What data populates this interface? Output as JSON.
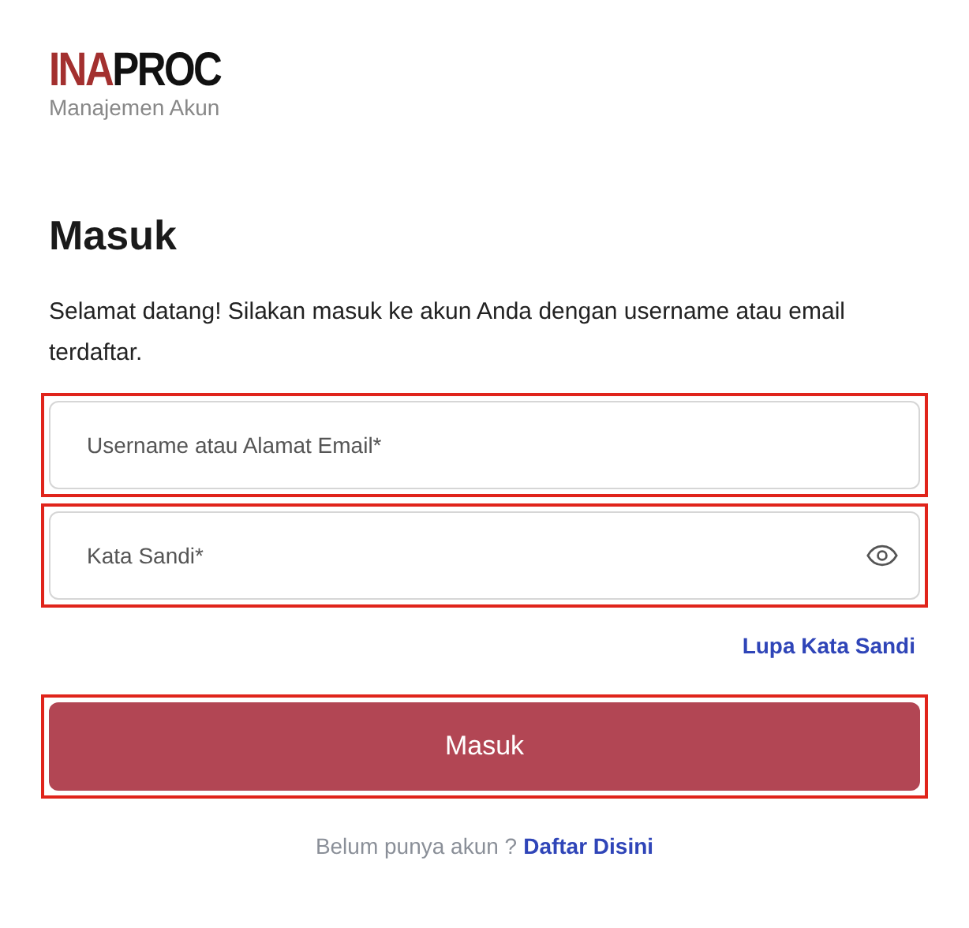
{
  "logo": {
    "parts": [
      {
        "text": "INA",
        "color": "#a3302f"
      },
      {
        "text": "PROC",
        "color": "#111111"
      }
    ],
    "subtitle": "Manajemen Akun"
  },
  "heading": "Masuk",
  "intro": "Selamat datang! Silakan masuk ke akun Anda dengan username atau email terdaftar.",
  "fields": [
    {
      "kind": "text",
      "placeholder": "Username atau Alamat Email*",
      "highlighted": true
    },
    {
      "kind": "password",
      "placeholder": "Kata Sandi*",
      "highlighted": true
    }
  ],
  "forgot_link": "Lupa Kata Sandi",
  "submit": {
    "label": "Masuk",
    "highlighted": true
  },
  "footer": {
    "text": "Belum punya akun ?",
    "link": "Daftar Disini"
  }
}
